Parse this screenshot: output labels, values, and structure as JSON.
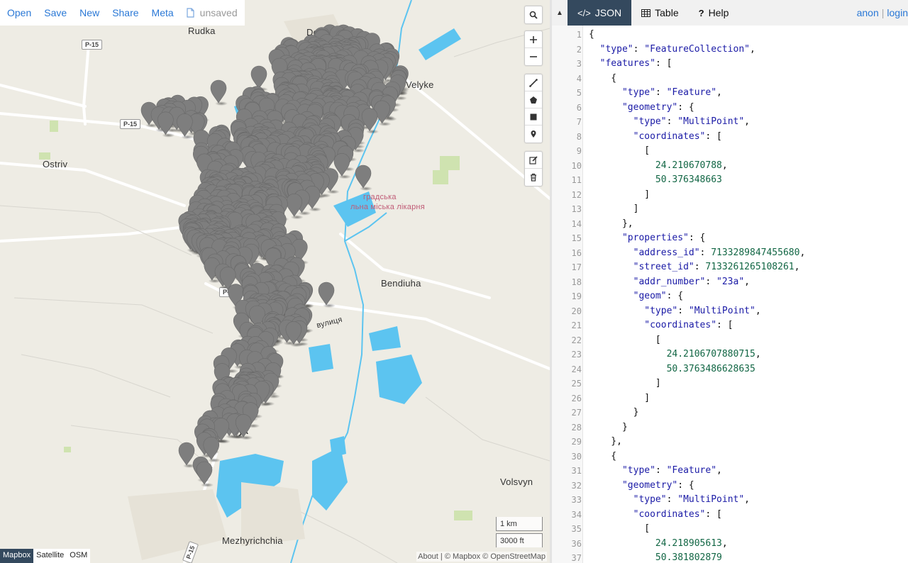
{
  "topbar": {
    "open": "Open",
    "save": "Save",
    "new": "New",
    "share": "Share",
    "meta": "Meta",
    "file_status": "unsaved"
  },
  "map": {
    "places": {
      "rudka": "Rudka",
      "dobriachyn": "Dobriachyn",
      "velyke": "Velyke",
      "ostriv": "Ostriv",
      "bendiuha": "Bendiuha",
      "volsvyn": "Volsvyn",
      "mezhyrichchia": "Mezhyrichchia",
      "street": "вулиця",
      "hospital_line1": "градська",
      "hospital_line2": "льна міська лікарня",
      "town_fragment": "ук"
    },
    "roads": {
      "p15": "P-15",
      "p15_partial": "P-1"
    },
    "scale": {
      "metric": "1 km",
      "imperial": "3000 ft"
    },
    "layers": [
      "Mapbox",
      "Satellite",
      "OSM"
    ],
    "active_layer": "Mapbox",
    "attribution": "About | © Mapbox © OpenStreetMap",
    "marker_color": "#7e7e7e",
    "water_color": "#5cc4f0"
  },
  "panel": {
    "tabs": [
      "JSON",
      "Table",
      "Help"
    ],
    "active_tab": "JSON",
    "auth": {
      "anon": "anon",
      "login": "login"
    }
  },
  "editor": {
    "lines": [
      "{",
      "  \"type\": \"FeatureCollection\",",
      "  \"features\": [",
      "    {",
      "      \"type\": \"Feature\",",
      "      \"geometry\": {",
      "        \"type\": \"MultiPoint\",",
      "        \"coordinates\": [",
      "          [",
      "            24.210670788,",
      "            50.376348663",
      "          ]",
      "        ]",
      "      },",
      "      \"properties\": {",
      "        \"address_id\": 7133289847455680,",
      "        \"street_id\": 7133261265108261,",
      "        \"addr_number\": \"23a\",",
      "        \"geom\": {",
      "          \"type\": \"MultiPoint\",",
      "          \"coordinates\": [",
      "            [",
      "              24.2106707880715,",
      "              50.3763486628635",
      "            ]",
      "          ]",
      "        }",
      "      }",
      "    },",
      "    {",
      "      \"type\": \"Feature\",",
      "      \"geometry\": {",
      "        \"type\": \"MultiPoint\",",
      "        \"coordinates\": [",
      "          [",
      "            24.218905613,",
      "            50.381802879"
    ]
  }
}
